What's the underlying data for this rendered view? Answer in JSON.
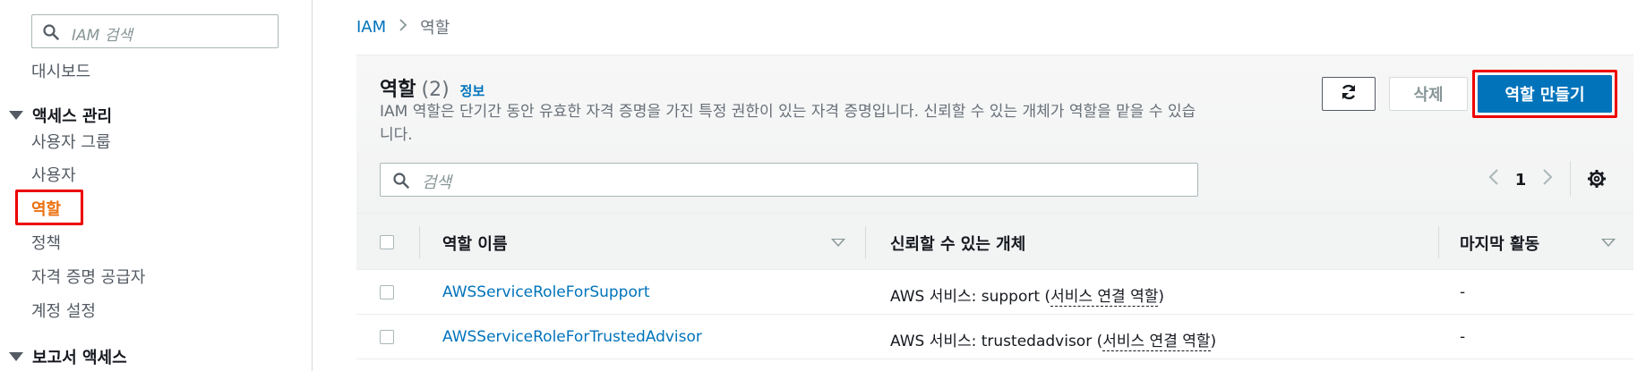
{
  "sidebar": {
    "search_placeholder": "IAM 검색",
    "dashboard": "대시보드",
    "access_section": "액세스 관리",
    "items": [
      "사용자 그룹",
      "사용자",
      "역할",
      "정책",
      "자격 증명 공급자",
      "계정 설정"
    ],
    "report_section": "보고서 액세스",
    "active_item": "역할"
  },
  "breadcrumb": {
    "root": "IAM",
    "current": "역할"
  },
  "roles_panel": {
    "title": "역할",
    "count": "(2)",
    "info_link": "정보",
    "description": "IAM 역할은 단기간 동안 유효한 자격 증명을 가진 특정 권한이 있는 자격 증명입니다. 신뢰할 수 있는 개체가 역할을 맡을 수 있습니다.",
    "delete_label": "삭제",
    "create_label": "역할 만들기",
    "search_placeholder": "검색",
    "page": "1"
  },
  "table": {
    "columns": [
      "역할 이름",
      "신뢰할 수 있는 개체",
      "마지막 활동"
    ],
    "rows": [
      {
        "name": "AWSServiceRoleForSupport",
        "entity_prefix": "AWS 서비스: support (",
        "entity_link": "서비스 연결 역할",
        "entity_suffix": ")",
        "last_activity": "-"
      },
      {
        "name": "AWSServiceRoleForTrustedAdvisor",
        "entity_prefix": "AWS 서비스: trustedadvisor (",
        "entity_link": "서비스 연결 역할",
        "entity_suffix": ")",
        "last_activity": "-"
      }
    ]
  },
  "colors": {
    "accent_link": "#0073bb",
    "active_nav": "#ec7211",
    "highlight_box": "#ee0000",
    "primary_button": "#0073bb"
  },
  "icons": [
    "search-icon",
    "caret-down-icon",
    "refresh-icon",
    "chevron-left-icon",
    "chevron-right-icon",
    "gear-icon",
    "sort-icon"
  ]
}
